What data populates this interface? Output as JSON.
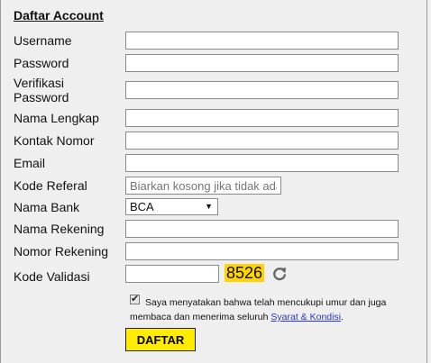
{
  "form": {
    "title": "Daftar Account",
    "labels": {
      "username": "Username",
      "password": "Password",
      "verify_password_line1": "Verifikasi",
      "verify_password_line2": "Password",
      "full_name": "Nama Lengkap",
      "contact": "Kontak Nomor",
      "email": "Email",
      "referral": "Kode Referal",
      "bank": "Nama Bank",
      "account_name": "Nama Rekening",
      "account_number": "Nomor Rekening",
      "validation": "Kode Validasi"
    },
    "referral_placeholder": "Biarkan kosong jika tidak ada",
    "bank_selected": "BCA",
    "captcha_code": "8526",
    "agree_text": "Saya menyatakan bahwa telah mencukupi umur dan juga membaca dan menerima seluruh ",
    "terms_link": "Syarat & Kondisi",
    "agree_suffix": ".",
    "agree_checked": true,
    "submit_label": "DAFTAR"
  },
  "colors": {
    "background": "#efefef",
    "captcha_highlight": "#ffd400",
    "submit_button": "#ffec00",
    "link": "#2a36c9"
  },
  "icons": {
    "refresh": "refresh-icon",
    "select_arrow": "chevron-down-icon"
  }
}
